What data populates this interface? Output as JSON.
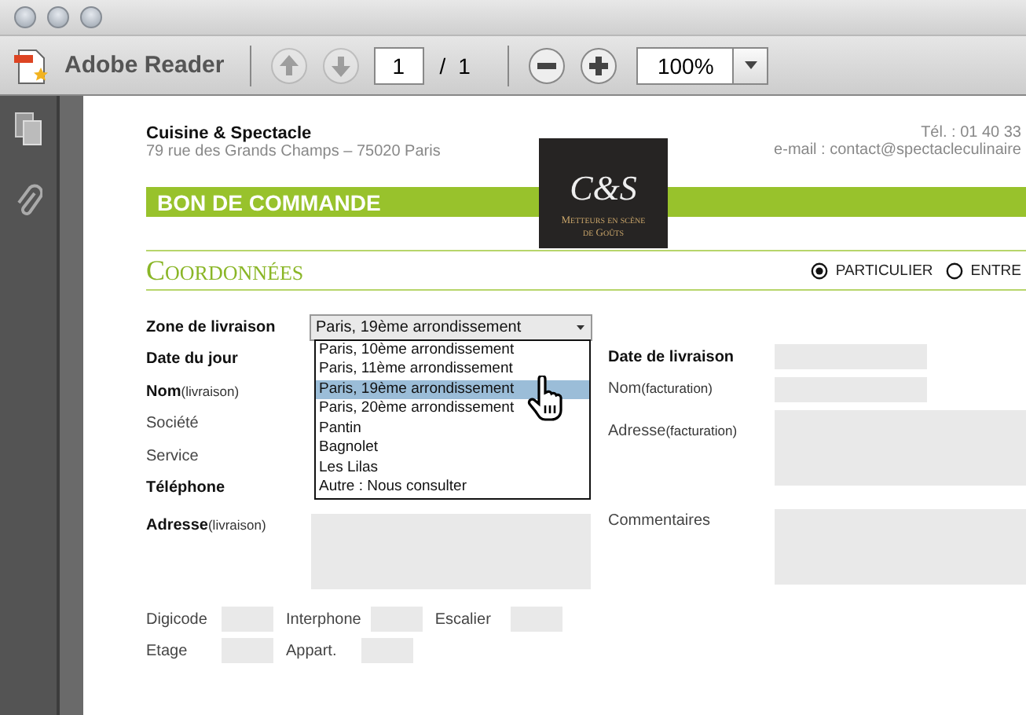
{
  "toolbar": {
    "app_name": "Adobe Reader",
    "page": "1",
    "separator": "/",
    "page_total": "1",
    "zoom": "100%",
    "prev_disabled": true,
    "next_disabled": true
  },
  "document": {
    "company": "Cuisine & Spectacle",
    "address": "79 rue des Grands Champs – 75020 Paris",
    "phone": "Tél. : 01 40 33",
    "email": "e-mail : contact@spectacleculinaire",
    "logo": {
      "monogram": "C&S",
      "tagline_1": "Metteurs en scène",
      "tagline_2": "de Goûts"
    },
    "banner": "BON DE COMMANDE",
    "section": "Coordonnées",
    "customer_type": [
      {
        "label": "PARTICULIER",
        "selected": true
      },
      {
        "label": "ENTRE",
        "selected": false
      }
    ],
    "zone": {
      "label": "Zone de livraison",
      "value": "Paris, 19ème arrondissement",
      "expanded": true,
      "options": [
        {
          "label": "Paris, 10ème arrondissement",
          "selected": false
        },
        {
          "label": "Paris, 11ème arrondissement",
          "selected": false
        },
        {
          "label": "Paris, 19ème arrondissement",
          "selected": true
        },
        {
          "label": "Paris, 20ème arrondissement",
          "selected": false
        },
        {
          "label": "Pantin",
          "selected": false
        },
        {
          "label": "Bagnolet",
          "selected": false
        },
        {
          "label": "Les Lilas",
          "selected": false
        },
        {
          "label": "Autre : Nous consulter",
          "selected": false
        }
      ]
    },
    "left_fields": [
      {
        "label": "Date du jour",
        "bold": true
      },
      {
        "label": "Nom",
        "note": "(livraison)",
        "bold": true
      },
      {
        "label": "Société",
        "bold": false
      },
      {
        "label": "Service",
        "bold": false
      },
      {
        "label": "Téléphone",
        "bold": true
      }
    ],
    "delivery_address": {
      "label": "Adresse",
      "note": "(livraison)"
    },
    "right_fields": [
      {
        "label": "Date de livraison",
        "bold": true,
        "kind": "short"
      },
      {
        "label": "Nom",
        "note": "(facturation)",
        "bold": false,
        "kind": "short"
      },
      {
        "label": "Adresse",
        "note": "(facturation)",
        "bold": false,
        "kind": "tall"
      }
    ],
    "comments": {
      "label": "Commentaires"
    },
    "access_rows": [
      [
        {
          "label": "Digicode"
        },
        {
          "label": "Interphone"
        },
        {
          "label": "Escalier"
        }
      ],
      [
        {
          "label": "Etage"
        },
        {
          "label": "Appart."
        }
      ]
    ]
  }
}
